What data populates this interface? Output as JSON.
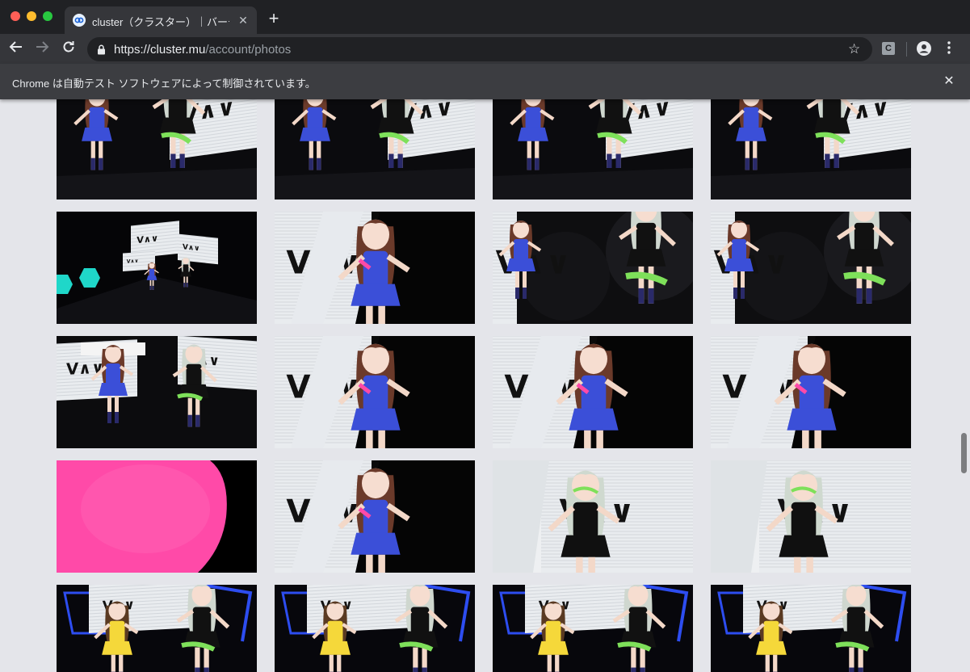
{
  "browser": {
    "tab_title": "cluster（クラスター）｜バーチャル",
    "url_host": "https://cluster.mu",
    "url_path": "/account/photos",
    "infobar_text": "Chrome は自動テスト ソフトウェアによって制御されています。",
    "extension_label": "C"
  },
  "photos": [
    {
      "scene": "stage-duo-wide"
    },
    {
      "scene": "stage-duo-wide"
    },
    {
      "scene": "stage-duo-wide"
    },
    {
      "scene": "stage-duo-wide"
    },
    {
      "scene": "venue-overview"
    },
    {
      "scene": "closeup-brown-hair"
    },
    {
      "scene": "stage-duo-mid"
    },
    {
      "scene": "stage-duo-mid"
    },
    {
      "scene": "stage-duo-screens"
    },
    {
      "scene": "closeup-brown-hair"
    },
    {
      "scene": "closeup-brown-hair"
    },
    {
      "scene": "closeup-brown-hair"
    },
    {
      "scene": "pink-heart"
    },
    {
      "scene": "closeup-brown-hair"
    },
    {
      "scene": "closeup-silver-hair"
    },
    {
      "scene": "closeup-silver-hair"
    },
    {
      "scene": "stage-yellow-blue"
    },
    {
      "scene": "stage-yellow-blue"
    },
    {
      "scene": "stage-yellow-blue"
    },
    {
      "scene": "stage-yellow-blue"
    }
  ],
  "colors": {
    "page_bg": "#e4e5ea",
    "chrome_dark": "#202124",
    "toolbar": "#35363a",
    "infobar": "#3c3d41",
    "accent_blue": "#3b4fd8",
    "accent_pink": "#ff4aa8",
    "accent_green": "#7ee05a"
  }
}
